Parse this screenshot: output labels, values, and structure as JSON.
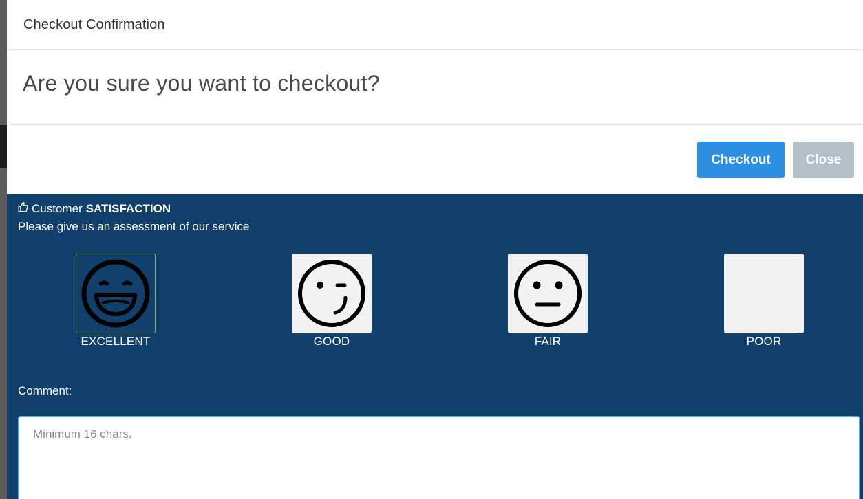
{
  "dialog": {
    "title": "Checkout Confirmation",
    "question": "Are you sure you want to checkout?",
    "buttons": {
      "checkout_label": "Checkout",
      "close_label": "Close"
    }
  },
  "satisfaction": {
    "title_prefix": "Customer",
    "title_bold": "SATISFACTION",
    "subtitle": "Please give us an assessment of our service",
    "options": [
      {
        "label": "EXCELLENT",
        "icon": "grinning-face-icon",
        "selected": true
      },
      {
        "label": "GOOD",
        "icon": "winking-face-icon",
        "selected": false
      },
      {
        "label": "FAIR",
        "icon": "neutral-face-icon",
        "selected": false
      },
      {
        "label": "POOR",
        "icon": "",
        "selected": false
      }
    ],
    "comment_label": "Comment:",
    "comment_placeholder": "Minimum 16 chars.",
    "comment_value": ""
  },
  "colors": {
    "panel_bg": "#12406c",
    "checkout_button": "#2c8fe2",
    "close_button": "#b3c0c8",
    "selected_border": "#8db368"
  }
}
